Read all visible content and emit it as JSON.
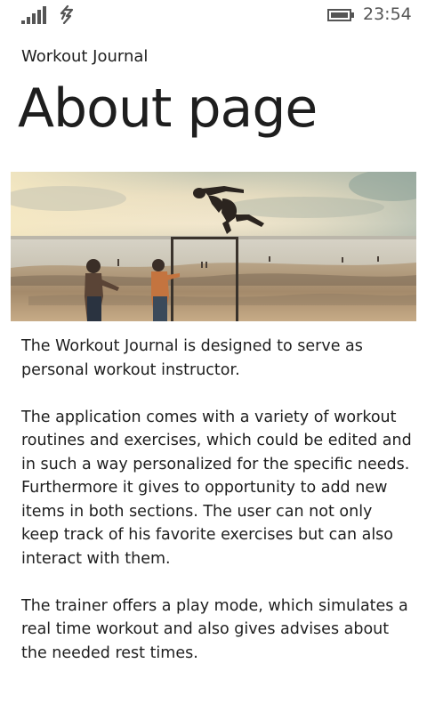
{
  "status_bar": {
    "time": "23:54",
    "signal_icon": "cellular-signal-icon",
    "data_icon": "data-connection-icon",
    "battery_icon": "battery-icon"
  },
  "header": {
    "app_title": "Workout Journal",
    "page_title": "About page"
  },
  "hero_image": {
    "subject": "beach workout photo"
  },
  "content": {
    "paragraphs": [
      "The Workout Journal is designed to serve as personal workout instructor.",
      "The application comes with a variety of workout routines and exercises, which could be edited and in such a way personalized for the specific needs. Furthermore it gives to opportunity to add new items in both sections. The user can not only keep track of his favorite exercises but can also interact with them.",
      "The trainer offers a play mode, which simulates a real time workout and also gives advises about the needed rest times."
    ]
  },
  "colors": {
    "text": "#1e1e1e",
    "status_text": "#555555",
    "background": "#ffffff"
  }
}
